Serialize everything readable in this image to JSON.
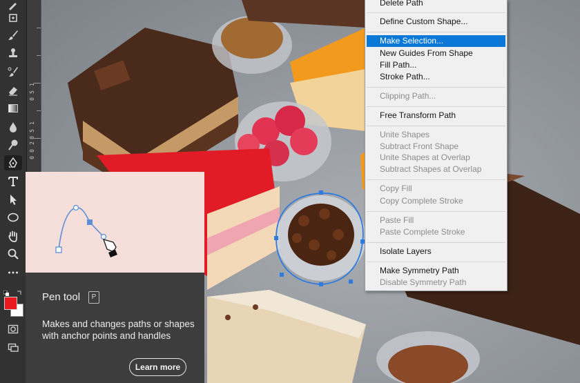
{
  "toolbar": {
    "tools": [
      "brush-icon",
      "spot-healing-icon",
      "paintbrush-icon",
      "clone-stamp-icon",
      "history-brush-icon",
      "eraser-icon",
      "gradient-icon",
      "blur-drop-icon",
      "dodge-icon",
      "pen-icon",
      "type-icon",
      "path-selection-icon",
      "ellipse-icon",
      "hand-icon",
      "zoom-icon",
      "more-tools-icon"
    ],
    "foreground_color": "#e8191d",
    "background_color": "#ffffff"
  },
  "ruler": {
    "labels": [
      "1",
      "5",
      "0",
      "1",
      "5",
      "0",
      "2",
      "0",
      "0"
    ]
  },
  "tooltip": {
    "title": "Pen tool",
    "shortcut": "P",
    "description": "Makes and changes paths or shapes with anchor points and handles",
    "learn_more": "Learn more",
    "illustration_bg": "#f6dfdb",
    "path_color": "#5b8fd6"
  },
  "context_menu": {
    "highlight_color": "#0a78d7",
    "items": [
      {
        "label": "Delete Path",
        "state": "normal"
      },
      {
        "label": "Define Custom Shape...",
        "state": "normal"
      },
      {
        "label": "Make Selection...",
        "state": "highlighted"
      },
      {
        "label": "New Guides From Shape",
        "state": "normal"
      },
      {
        "label": "Fill Path...",
        "state": "normal"
      },
      {
        "label": "Stroke Path...",
        "state": "normal"
      },
      {
        "label": "Clipping Path...",
        "state": "disabled"
      },
      {
        "label": "Free Transform Path",
        "state": "normal"
      },
      {
        "label": "Unite Shapes",
        "state": "disabled"
      },
      {
        "label": "Subtract Front Shape",
        "state": "disabled"
      },
      {
        "label": "Unite Shapes at Overlap",
        "state": "disabled"
      },
      {
        "label": "Subtract Shapes at Overlap",
        "state": "disabled"
      },
      {
        "label": "Copy Fill",
        "state": "disabled"
      },
      {
        "label": "Copy Complete Stroke",
        "state": "disabled"
      },
      {
        "label": "Paste Fill",
        "state": "disabled"
      },
      {
        "label": "Paste Complete Stroke",
        "state": "disabled"
      },
      {
        "label": "Isolate Layers",
        "state": "normal"
      },
      {
        "label": "Make Symmetry Path",
        "state": "normal"
      },
      {
        "label": "Disable Symmetry Path",
        "state": "disabled"
      }
    ]
  }
}
